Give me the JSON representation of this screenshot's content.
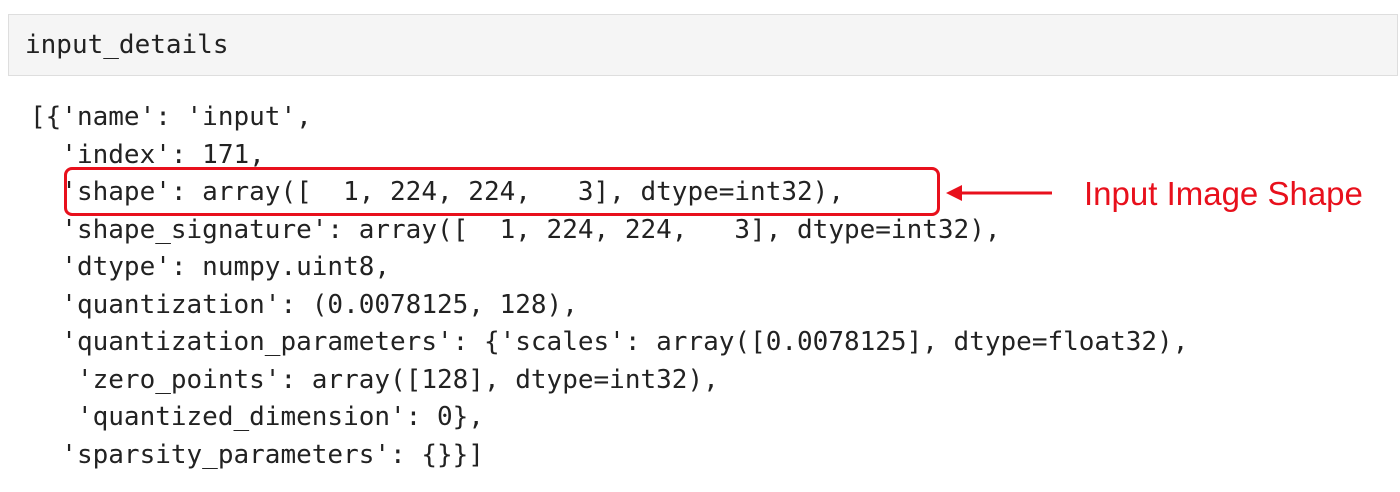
{
  "input_cell": {
    "code": "input_details"
  },
  "output": {
    "lines": [
      "[{'name': 'input',",
      "  'index': 171,",
      "  'shape': array([  1, 224, 224,   3], dtype=int32),",
      "  'shape_signature': array([  1, 224, 224,   3], dtype=int32),",
      "  'dtype': numpy.uint8,",
      "  'quantization': (0.0078125, 128),",
      "  'quantization_parameters': {'scales': array([0.0078125], dtype=float32),",
      "   'zero_points': array([128], dtype=int32),",
      "   'quantized_dimension': 0},",
      "  'sparsity_parameters': {}}]"
    ]
  },
  "annotation": {
    "label": "Input Image Shape",
    "color": "#e8101c"
  },
  "colors": {
    "input_background": "#f5f5f5",
    "text": "#222222",
    "accent": "#e8101c"
  }
}
